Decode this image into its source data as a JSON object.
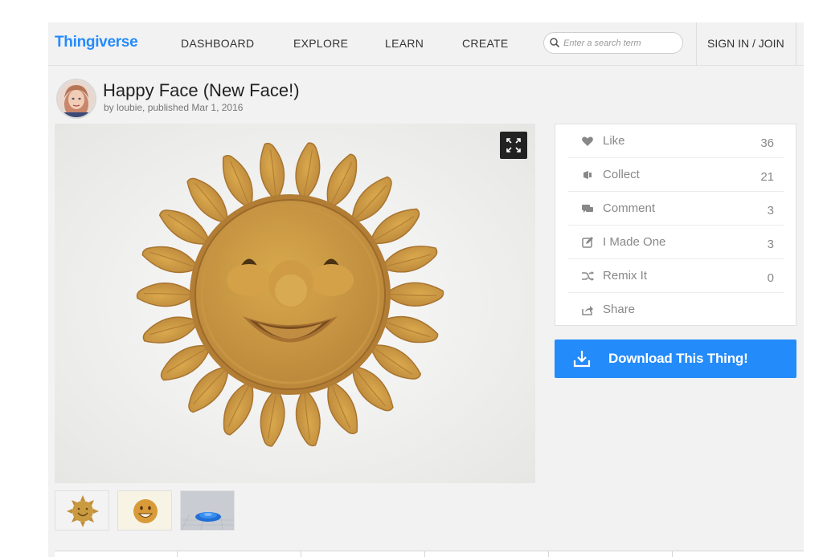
{
  "nav": {
    "logo": "Thingiverse",
    "links": [
      "DASHBOARD",
      "EXPLORE",
      "LEARN",
      "CREATE"
    ],
    "search_placeholder": "Enter a search term",
    "signin": "SIGN IN / JOIN"
  },
  "thing": {
    "title": "Happy Face (New Face!)",
    "byline": "by loubie, published Mar 1, 2016"
  },
  "stats": [
    {
      "label": "Like",
      "count": "36",
      "icon": "heart-icon"
    },
    {
      "label": "Collect",
      "count": "21",
      "icon": "collect-icon"
    },
    {
      "label": "Comment",
      "count": "3",
      "icon": "comment-icon"
    },
    {
      "label": "I Made One",
      "count": "3",
      "icon": "made-icon"
    },
    {
      "label": "Remix It",
      "count": "0",
      "icon": "remix-icon"
    },
    {
      "label": "Share",
      "icon": "share-icon"
    }
  ],
  "download_label": "Download This Thing!",
  "colors": {
    "brand": "#248bfb",
    "object": "#c99a3f"
  }
}
